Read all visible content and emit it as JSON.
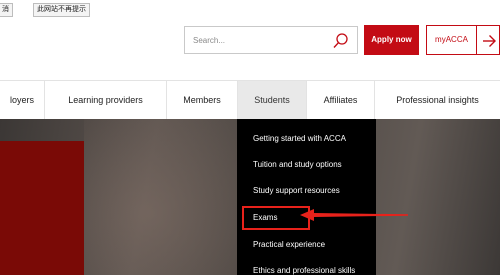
{
  "notice": {
    "left_button": "消",
    "dismiss_button": "此网站不再提示"
  },
  "header": {
    "search": {
      "placeholder": "Search..."
    },
    "apply_button": "Apply now",
    "myacca_button": "myACCA"
  },
  "nav": {
    "items": [
      {
        "label": "loyers"
      },
      {
        "label": "Learning providers"
      },
      {
        "label": "Members"
      },
      {
        "label": "Students",
        "active": true
      },
      {
        "label": "Affiliates"
      },
      {
        "label": "Professional insights"
      }
    ]
  },
  "dropdown": {
    "items": [
      "Getting started with ACCA",
      "Tuition and study options",
      "Study support resources",
      "Exams",
      "Practical experience",
      "Ethics and professional skills"
    ]
  },
  "colors": {
    "brand_red": "#c30b14",
    "annotation_red": "#e8221b",
    "dropdown_bg": "#000000"
  },
  "icons": [
    "search-icon",
    "arrow-right-icon"
  ]
}
